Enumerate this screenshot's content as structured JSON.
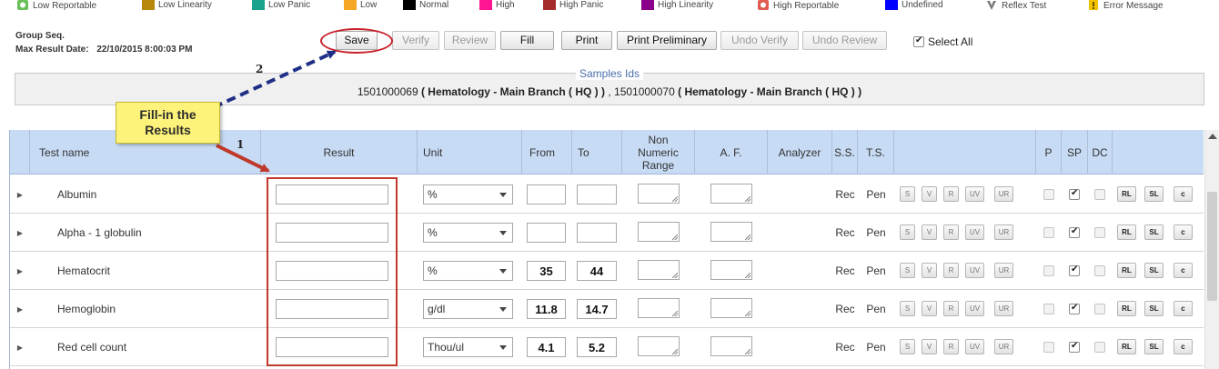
{
  "legend": [
    {
      "label": "Low Reportable",
      "color": "#6bbf59",
      "icon": "low-reportable-icon"
    },
    {
      "label": "Low Linearity",
      "color": "#b8860b",
      "icon": "low-linearity-swatch"
    },
    {
      "label": "Low Panic",
      "color": "#1aa38c",
      "icon": "low-panic-swatch"
    },
    {
      "label": "Low",
      "color": "#f5a623",
      "icon": "low-swatch"
    },
    {
      "label": "Normal",
      "color": "#000000",
      "icon": "normal-swatch"
    },
    {
      "label": "High",
      "color": "#ff1493",
      "icon": "high-swatch"
    },
    {
      "label": "High Panic",
      "color": "#a52a2a",
      "icon": "high-panic-swatch"
    },
    {
      "label": "High Linearity",
      "color": "#8b008b",
      "icon": "high-linearity-swatch"
    },
    {
      "label": "High Reportable",
      "color": "#e05a4f",
      "icon": "high-reportable-icon"
    },
    {
      "label": "Undefined",
      "color": "#0000ff",
      "icon": "undefined-swatch"
    },
    {
      "label": "Reflex Test",
      "color": "#777777",
      "icon": "reflex-test-icon"
    },
    {
      "label": "Error Message",
      "color": "#f2c200",
      "icon": "error-message-icon"
    }
  ],
  "info": {
    "group_seq_label": "Group Seq.",
    "max_result_label": "Max Result Date:",
    "max_result_value": "22/10/2015 8:00:03 PM"
  },
  "toolbar": {
    "save": "Save",
    "verify": "Verify",
    "review": "Review",
    "fill": "Fill",
    "print": "Print",
    "print_preliminary": "Print Preliminary",
    "undo_verify": "Undo Verify",
    "undo_review": "Undo Review",
    "select_all": "Select All"
  },
  "samples": {
    "title": "Samples Ids",
    "id1": "1501000069",
    "dept1": "( Hematology - Main Branch ( HQ ) )",
    "sep": ",",
    "id2": "1501000070",
    "dept2": "( Hematology - Main Branch ( HQ ) )"
  },
  "annotations": {
    "callout": "Fill-in the Results",
    "step1": "1",
    "step2": "2"
  },
  "columns": {
    "test_name": "Test name",
    "result": "Result",
    "unit": "Unit",
    "from": "From",
    "to": "To",
    "non_numeric_range": "Non Numeric Range",
    "af": "A. F.",
    "analyzer": "Analyzer",
    "ss": "S.S.",
    "ts": "T.S.",
    "p": "P",
    "sp": "SP",
    "dc": "DC"
  },
  "row_buttons": {
    "s": "S",
    "v": "V",
    "r": "R",
    "uv": "UV",
    "ur": "UR",
    "rl": "RL",
    "sl": "SL",
    "c": "c"
  },
  "rows": [
    {
      "test": "Albumin",
      "unit": "%",
      "from": "",
      "to": "",
      "ss": "Rec",
      "ts": "Pen"
    },
    {
      "test": "Alpha - 1 globulin",
      "unit": "%",
      "from": "",
      "to": "",
      "ss": "Rec",
      "ts": "Pen"
    },
    {
      "test": "Hematocrit",
      "unit": "%",
      "from": "35",
      "to": "44",
      "ss": "Rec",
      "ts": "Pen"
    },
    {
      "test": "Hemoglobin",
      "unit": "g/dl",
      "from": "11.8",
      "to": "14.7",
      "ss": "Rec",
      "ts": "Pen"
    },
    {
      "test": "Red cell count",
      "unit": "Thou/ul",
      "from": "4.1",
      "to": "5.2",
      "ss": "Rec",
      "ts": "Pen"
    }
  ]
}
